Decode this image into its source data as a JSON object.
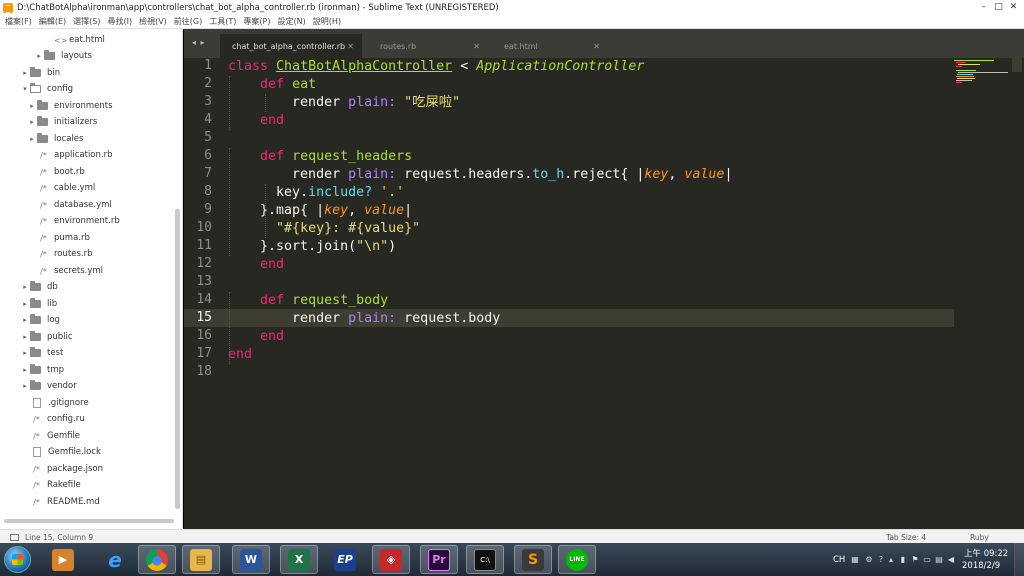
{
  "window": {
    "title": "D:\\ChatBotAlpha\\ironman\\app\\controllers\\chat_bot_alpha_controller.rb (ironman) - Sublime Text (UNREGISTERED)",
    "controls": [
      "–",
      "□",
      "✕"
    ]
  },
  "menu": [
    "檔案(F)",
    "編輯(E)",
    "選擇(S)",
    "尋找(I)",
    "檢視(V)",
    "前往(G)",
    "工具(T)",
    "專案(P)",
    "設定(N)",
    "說明(H)"
  ],
  "sidebar": {
    "items": [
      {
        "label": "eat.html",
        "kind": "file-html"
      },
      {
        "label": "layouts",
        "kind": "folder"
      },
      {
        "label": "bin",
        "kind": "folder"
      },
      {
        "label": "config",
        "kind": "folder-open"
      },
      {
        "label": "environments",
        "kind": "folder"
      },
      {
        "label": "initializers",
        "kind": "folder"
      },
      {
        "label": "locales",
        "kind": "folder"
      },
      {
        "label": "application.rb",
        "kind": "file"
      },
      {
        "label": "boot.rb",
        "kind": "file"
      },
      {
        "label": "cable.yml",
        "kind": "file"
      },
      {
        "label": "database.yml",
        "kind": "file"
      },
      {
        "label": "environment.rb",
        "kind": "file"
      },
      {
        "label": "puma.rb",
        "kind": "file"
      },
      {
        "label": "routes.rb",
        "kind": "file"
      },
      {
        "label": "secrets.yml",
        "kind": "file"
      },
      {
        "label": "db",
        "kind": "folder"
      },
      {
        "label": "lib",
        "kind": "folder"
      },
      {
        "label": "log",
        "kind": "folder"
      },
      {
        "label": "public",
        "kind": "folder"
      },
      {
        "label": "test",
        "kind": "folder"
      },
      {
        "label": "tmp",
        "kind": "folder"
      },
      {
        "label": "vendor",
        "kind": "folder"
      },
      {
        "label": ".gitignore",
        "kind": "page"
      },
      {
        "label": "config.ru",
        "kind": "file"
      },
      {
        "label": "Gemfile",
        "kind": "file"
      },
      {
        "label": "Gemfile.lock",
        "kind": "page"
      },
      {
        "label": "package.json",
        "kind": "file"
      },
      {
        "label": "Rakefile",
        "kind": "file"
      },
      {
        "label": "README.md",
        "kind": "file"
      }
    ]
  },
  "tabs": {
    "nav": "◂ ▸",
    "items": [
      {
        "label": "chat_bot_alpha_controller.rb",
        "close": "✕"
      },
      {
        "label": "routes.rb",
        "close": "✕"
      },
      {
        "label": "eat.html",
        "close": "✕"
      }
    ]
  },
  "editor": {
    "line_numbers": [
      "1",
      "2",
      "3",
      "4",
      "5",
      "6",
      "7",
      "8",
      "9",
      "10",
      "11",
      "12",
      "13",
      "14",
      "15",
      "16",
      "17",
      "18"
    ],
    "current_line": 15,
    "code": {
      "l1": [
        "class",
        "ChatBotAlphaController",
        "<",
        "ApplicationController"
      ],
      "l2": [
        "def",
        "eat"
      ],
      "l3": [
        "render",
        "plain:",
        "\"吃屎啦\""
      ],
      "l4": [
        "end"
      ],
      "l6": [
        "def",
        "request_headers"
      ],
      "l7": [
        "render",
        "plain:",
        "request.headers.",
        "to_h",
        ".reject{ |",
        "key",
        ", ",
        "value",
        "|"
      ],
      "l8": [
        "key.",
        "include?",
        "'.'"
      ],
      "l9": [
        "}.map{ |",
        "key",
        ", ",
        "value",
        "|"
      ],
      "l10": [
        "\"#{key}: #{value}\""
      ],
      "l11": [
        "}.sort.join(",
        "\"\\n\"",
        ")"
      ],
      "l12": [
        "end"
      ],
      "l14": [
        "def",
        "request_body"
      ],
      "l15": [
        "render",
        "plain:",
        "request.body"
      ],
      "l16": [
        "end"
      ],
      "l17": [
        "end"
      ]
    }
  },
  "status": {
    "position": "Line 15, Column 9",
    "tab_size": "Tab Size: 4",
    "syntax": "Ruby"
  },
  "taskbar": {
    "apps": [
      {
        "name": "media",
        "glyph": "▶",
        "color": "#d9822b"
      },
      {
        "name": "ie",
        "glyph": "e",
        "color": "#1e90ff"
      },
      {
        "name": "chrome",
        "glyph": "●",
        "color": "#db4437"
      },
      {
        "name": "explorer",
        "glyph": "▤",
        "color": "#e8b64a"
      },
      {
        "name": "word",
        "glyph": "W",
        "color": "#2b579a"
      },
      {
        "name": "excel",
        "glyph": "X",
        "color": "#217346"
      },
      {
        "name": "ep",
        "glyph": "EP",
        "color": "#1b3f8f"
      },
      {
        "name": "other",
        "glyph": "◈",
        "color": "#c62828"
      },
      {
        "name": "premiere",
        "glyph": "Pr",
        "color": "#2a0a3a"
      },
      {
        "name": "cmd",
        "glyph": "C:\\",
        "color": "#111111"
      },
      {
        "name": "sublime",
        "glyph": "S",
        "color": "#ff9800"
      },
      {
        "name": "line",
        "glyph": "LINE",
        "color": "#00b900"
      }
    ],
    "ime": "CH",
    "time": "上午 09:22",
    "date": "2018/2/9"
  }
}
